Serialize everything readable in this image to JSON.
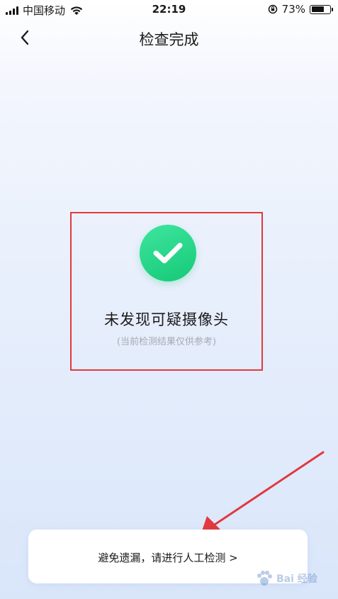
{
  "status_bar": {
    "carrier": "中国移动",
    "time": "22:19",
    "battery_percent": "73%",
    "battery_level": 0.73
  },
  "nav": {
    "back_icon": "chevron-left-icon",
    "title": "检查完成"
  },
  "result": {
    "icon": "check-circle-icon",
    "icon_color": "#1fd184",
    "highlight_color": "#e0393e",
    "title": "未发现可疑摄像头",
    "subtitle": "(当前检测结果仅供参考)"
  },
  "manual_check": {
    "label": "避免遗漏，请进行人工检测 >"
  },
  "annotation": {
    "arrow_color": "#e0393e"
  },
  "watermark": {
    "text": "Bai 经验"
  }
}
